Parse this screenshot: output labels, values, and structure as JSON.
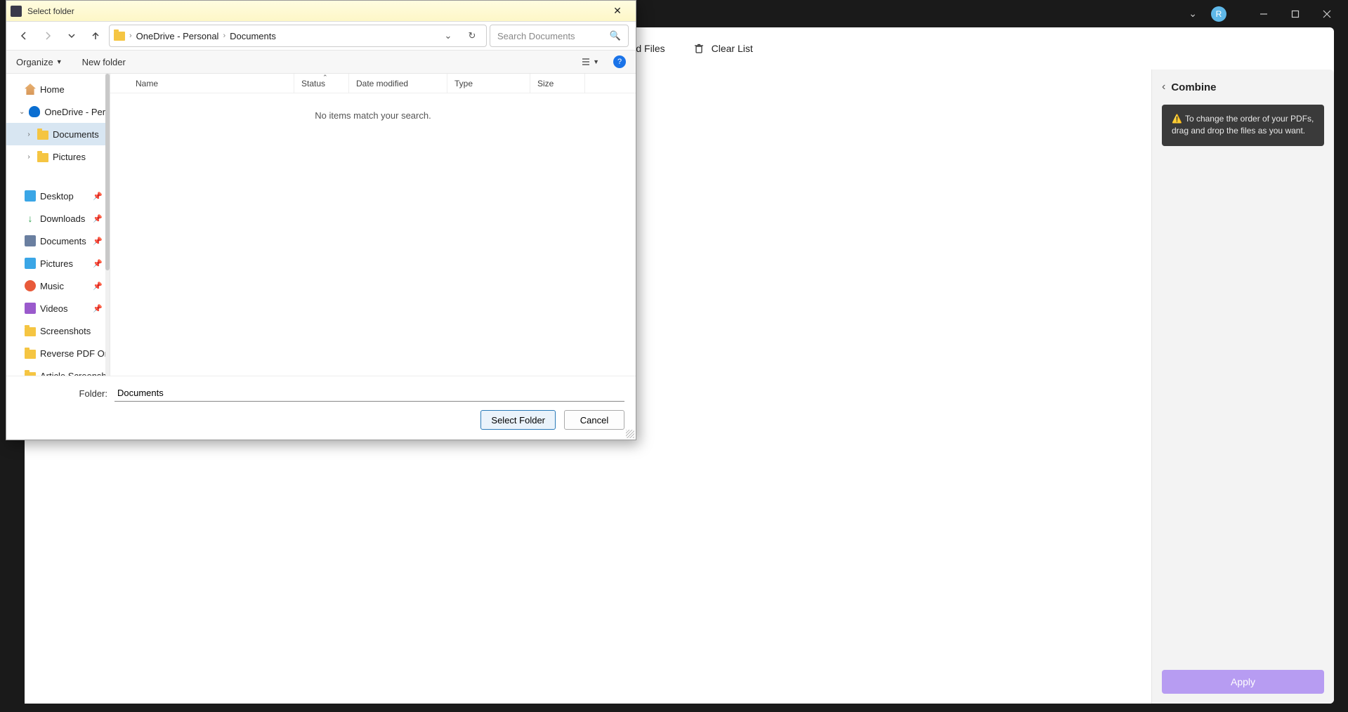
{
  "app": {
    "titlebar": {
      "avatar_initial": "R"
    },
    "toolbar": {
      "add_files": "Add Files",
      "clear_list": "Clear List"
    },
    "rightpanel": {
      "title": "Combine",
      "tip": "To change the order of your PDFs, drag and drop the files as you want.",
      "apply": "Apply"
    }
  },
  "dialog": {
    "title": "Select folder",
    "breadcrumb": {
      "seg1": "OneDrive - Personal",
      "seg2": "Documents"
    },
    "search_placeholder": "Search Documents",
    "toolbar": {
      "organize": "Organize",
      "new_folder": "New folder"
    },
    "tree": {
      "home": "Home",
      "onedrive": "OneDrive - Perso",
      "documents": "Documents",
      "pictures": "Pictures",
      "desktop": "Desktop",
      "downloads": "Downloads",
      "documents2": "Documents",
      "pictures2": "Pictures",
      "music": "Music",
      "videos": "Videos",
      "screenshots": "Screenshots",
      "reverse": "Reverse PDF Ord",
      "article": "Article Screensh"
    },
    "columns": {
      "name": "Name",
      "status": "Status",
      "date": "Date modified",
      "type": "Type",
      "size": "Size"
    },
    "empty": "No items match your search.",
    "footer": {
      "label": "Folder:",
      "value": "Documents",
      "select": "Select Folder",
      "cancel": "Cancel"
    }
  }
}
